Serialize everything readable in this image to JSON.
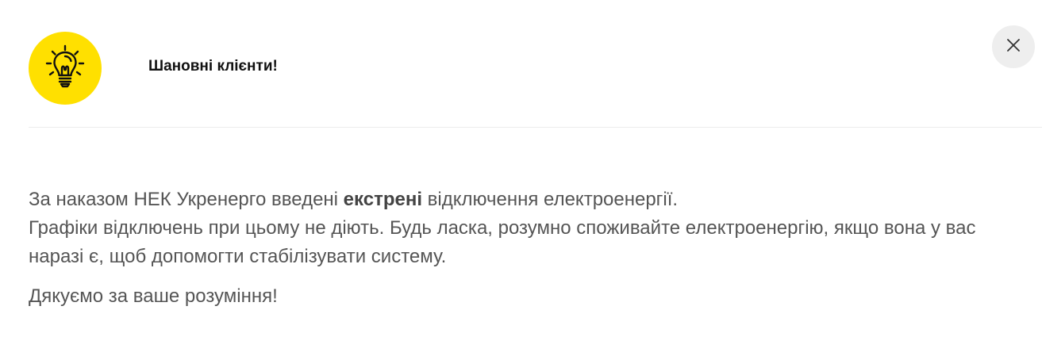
{
  "dialog": {
    "title": "Шановні клієнти!",
    "icon": "lightbulb-icon",
    "accent_color": "#ffe000",
    "close_icon": "close-icon"
  },
  "message": {
    "line1_before": "За наказом НЕК Укренерго введені ",
    "line1_bold": "екстрені",
    "line1_after": " відключення електроенергії.",
    "line2": "Графіки відключень при цьому не діють.  Будь ласка, розумно споживайте електроенергію, якщо вона у вас наразі є, щоб допомогти стабілізувати систему.",
    "thanks": "Дякуємо за ваше розуміння!"
  }
}
